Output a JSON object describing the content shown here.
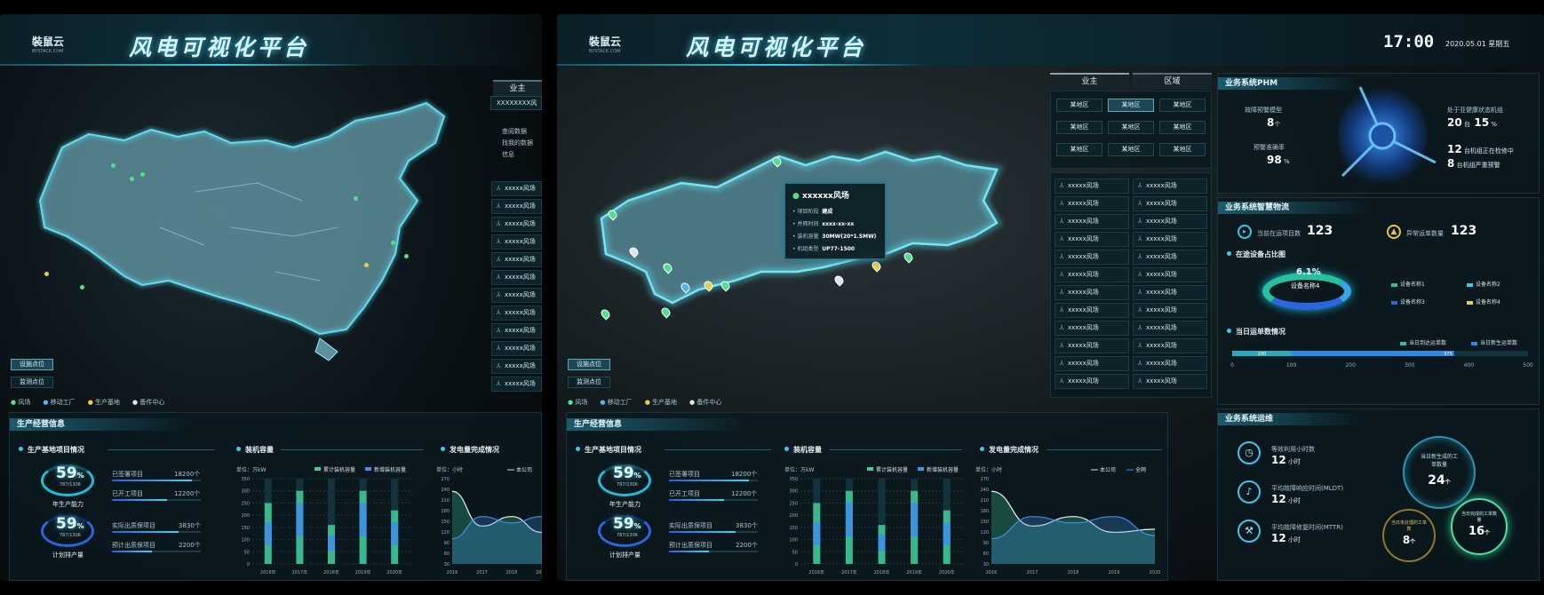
{
  "brand": {
    "name": "裝鼠云",
    "sub": "BYSTACK.COM"
  },
  "title": "风电可视化平台",
  "clock": {
    "time": "17:00",
    "date": "2020.05.01 星期五"
  },
  "tabs": {
    "owner": "业主",
    "region": "区域"
  },
  "region_cells": [
    "某地区",
    "某地区",
    "某地区",
    "某地区",
    "某地区",
    "某地区",
    "某地区",
    "某地区",
    "某地区"
  ],
  "left_list": {
    "header": "业主",
    "search_placeholder": "XXXXXXXX风",
    "links": [
      "查阅数据",
      "找我的数据",
      "信息"
    ]
  },
  "farms": [
    "xxxxx风场",
    "xxxxx风场",
    "xxxxx风场",
    "xxxxx风场",
    "xxxxx风场",
    "xxxxx风场",
    "xxxxx风场",
    "xxxxx风场",
    "xxxxx风场",
    "xxxxx风场",
    "xxxxx风场",
    "xxxxx风场",
    "xxxxx风场",
    "xxxxx风场",
    "xxxxx风场",
    "xxxxx风场",
    "xxxxx风场",
    "xxxxx风场",
    "xxxxx风场",
    "xxxxx风场",
    "xxxxx风场",
    "xxxxx风场",
    "xxxxx风场",
    "xxxxx风场"
  ],
  "map_buttons": {
    "facilities": "设施点位",
    "monitor": "监测点位"
  },
  "map_legend": [
    "风场",
    "移动工厂",
    "生产基地",
    "备件中心"
  ],
  "popup": {
    "title": "xxxxxx风场",
    "rows": [
      {
        "k": "项目阶段",
        "v": "建成"
      },
      {
        "k": "并网时间",
        "v": "xxxx-xx-xx"
      },
      {
        "k": "装机容量",
        "v": "30MW(20*1.5MW)"
      },
      {
        "k": "机组类型",
        "v": "UP77-1500"
      }
    ]
  },
  "production": {
    "title": "生产经营信息",
    "base": {
      "title": "生产基地项目情况",
      "pct1": "59",
      "ratio1": "787/1306",
      "label1": "年生产能力",
      "pct2": "59",
      "ratio2": "787/1306",
      "label2": "计划排产量"
    },
    "rows": [
      {
        "label": "已签署项目",
        "value": "18200个",
        "fill": 0.9
      },
      {
        "label": "已开工项目",
        "value": "12200个",
        "fill": 0.62
      },
      {
        "label": "实际出质保项目",
        "value": "3830个",
        "fill": 0.75
      },
      {
        "label": "预计出质保项目",
        "value": "2200个",
        "fill": 0.45
      }
    ]
  },
  "capacity": {
    "title": "装机容量",
    "unit": "单位：万kW",
    "legend": [
      "累计装机容量",
      "新增装机容量"
    ],
    "years": [
      "2016年",
      "2017年",
      "2018年",
      "2019年",
      "2020年"
    ],
    "yticks": [
      "350",
      "300",
      "250",
      "200",
      "150",
      "100",
      "50",
      "0"
    ]
  },
  "generation": {
    "title": "发电量完成情况",
    "unit": "单位：小时",
    "legend": [
      "本公司",
      "全网"
    ],
    "years": [
      "2016",
      "2017",
      "2018",
      "2019",
      "2020"
    ],
    "yticks": [
      "270",
      "240",
      "210",
      "180",
      "150",
      "120",
      "90",
      "60",
      "30"
    ]
  },
  "phm": {
    "title": "业务系统PHM",
    "fault_model_label": "故障预警模型",
    "fault_model_value": "8",
    "fault_model_unit": "个",
    "warn_acc_label": "预警准确率",
    "warn_acc_value": "98",
    "warn_acc_unit": "%",
    "health_label": "处于亚健康状态机组",
    "health_value": "20",
    "health_unit": "台",
    "health_pct": "15",
    "health_pct_unit": "%",
    "item1_value": "12",
    "item1_label": "台机组正在检修中",
    "item2_value": "8",
    "item2_label": "台机组严重预警"
  },
  "logistics": {
    "title": "业务系统智慧物流",
    "in_transit_label": "当前在运项目数",
    "in_transit_value": "123",
    "abnormal_label": "异常运单数量",
    "abnormal_value": "123",
    "share_title": "在途设备占比图",
    "share_value": "6.1%",
    "share_name": "设备名称4",
    "devices": [
      "设备名称1",
      "设备名称2",
      "设备名称3",
      "设备名称4"
    ],
    "waybill_title": "当日运单数情况",
    "waybill_legend": [
      "当日到达运单数",
      "当日新生运单数"
    ],
    "waybill_ticks": [
      "0",
      "100",
      "200",
      "300",
      "400",
      "500"
    ],
    "waybill_a": "100",
    "waybill_b": "375"
  },
  "ops": {
    "title": "业务系统运维",
    "m1_label": "等效利用小时数",
    "m1_value": "12",
    "m1_unit": "小时",
    "m2_label": "平均故障响应时间(MLDT)",
    "m2_value": "12",
    "m2_unit": "小时",
    "m3_label": "平均故障修复时间(MTTR)",
    "m3_value": "12",
    "m3_unit": "小时",
    "c1_label": "当日新生成的工单数量",
    "c1_value": "24",
    "c1_unit": "个",
    "c2_label": "当日未处理的工单数",
    "c2_value": "8",
    "c2_unit": "个",
    "c3_label": "当日完成的工单数量",
    "c3_value": "16",
    "c3_unit": "个"
  },
  "chart_data": [
    {
      "type": "bar",
      "title": "装机容量",
      "ylabel": "单位：万kW",
      "categories": [
        "2016年",
        "2017年",
        "2018年",
        "2019年",
        "2020年"
      ],
      "ylim": [
        0,
        350
      ],
      "series": [
        {
          "name": "累计装机容量",
          "values": [
            250,
            300,
            160,
            300,
            220
          ]
        },
        {
          "name": "新增装机容量",
          "values": [
            170,
            250,
            120,
            250,
            170
          ]
        }
      ]
    },
    {
      "type": "area",
      "title": "发电量完成情况",
      "ylabel": "单位：小时",
      "categories": [
        "2016",
        "2017",
        "2018",
        "2019",
        "2020"
      ],
      "ylim": [
        0,
        270
      ],
      "series": [
        {
          "name": "本公司",
          "values": [
            230,
            120,
            150,
            100,
            110
          ]
        },
        {
          "name": "全网",
          "values": [
            80,
            150,
            130,
            150,
            90
          ]
        }
      ]
    }
  ]
}
